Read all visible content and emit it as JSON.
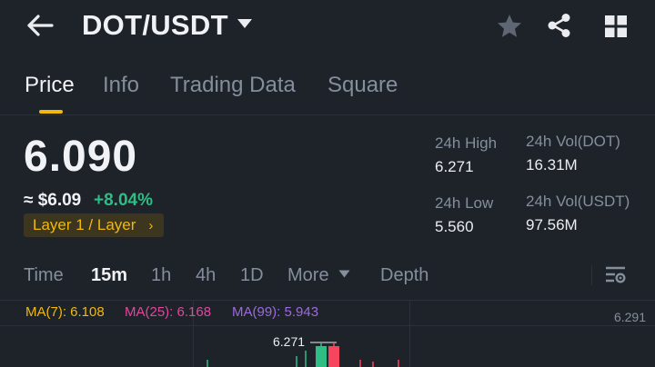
{
  "header": {
    "back_icon": "arrow-left-icon",
    "pair": "DOT/USDT",
    "dropdown_icon": "caret-down-icon",
    "favorite_icon": "star-icon",
    "share_icon": "share-icon",
    "grid_icon": "grid-icon"
  },
  "tabs": [
    {
      "label": "Price",
      "active": true
    },
    {
      "label": "Info",
      "active": false
    },
    {
      "label": "Trading Data",
      "active": false
    },
    {
      "label": "Square",
      "active": false
    }
  ],
  "ticker": {
    "last_price": "6.090",
    "usd_value": "≈ $6.09",
    "change_pct": "+8.04%",
    "tag": "Layer 1 / Layer",
    "tag_chevron": "›"
  },
  "stats": {
    "high_label": "24h High",
    "high_value": "6.271",
    "low_label": "24h Low",
    "low_value": "5.560",
    "vol_base_label": "24h Vol(DOT)",
    "vol_base_value": "16.31M",
    "vol_quote_label": "24h Vol(USDT)",
    "vol_quote_value": "97.56M"
  },
  "timeframes": {
    "items": [
      "Time",
      "15m",
      "1h",
      "4h",
      "1D"
    ],
    "selected": "15m",
    "more": "More",
    "depth": "Depth",
    "settings_icon": "chart-settings-icon"
  },
  "indicators": {
    "ma7": "MA(7): 6.108",
    "ma25": "MA(25): 6.168",
    "ma99": "MA(99): 5.943"
  },
  "chart": {
    "axis_top": "6.291",
    "high_marker": "6.271"
  },
  "colors": {
    "background": "#1e2329",
    "accent": "#f0b90b",
    "up": "#2ebd85",
    "down": "#f6465d",
    "ma7": "#f0b90b",
    "ma25": "#e0479e",
    "ma99": "#9c6ade"
  }
}
